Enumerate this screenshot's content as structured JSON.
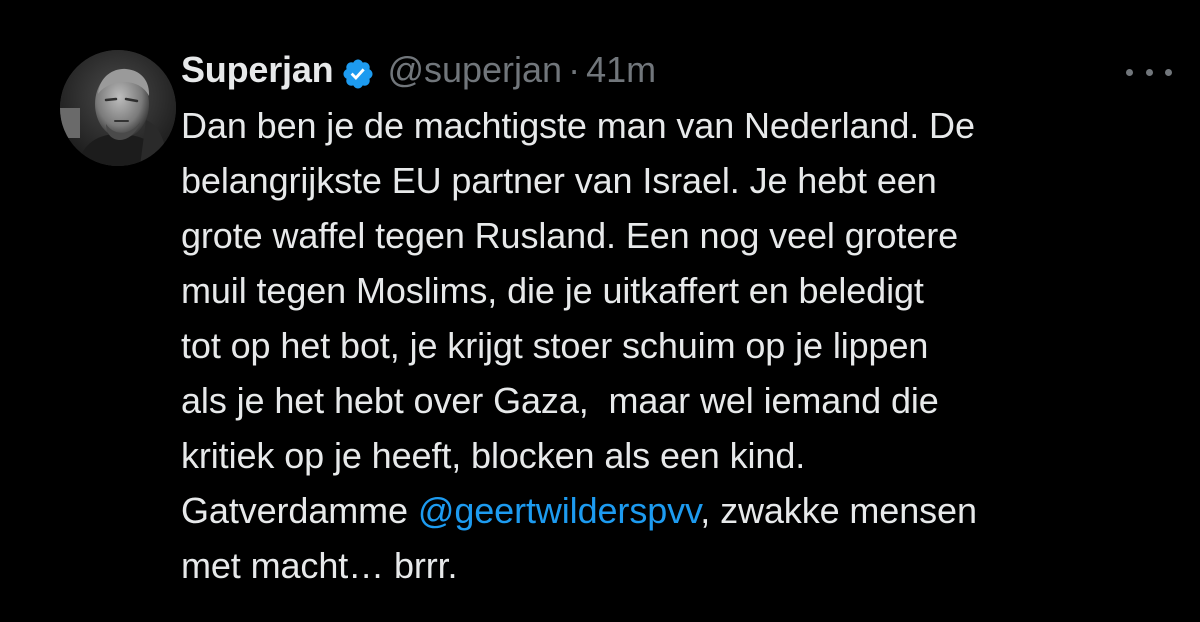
{
  "tweet": {
    "author": {
      "display_name": "Superjan",
      "handle": "@superjan",
      "verified": true,
      "verified_icon": "verified-badge-icon",
      "badge_color": "#1d9bf0"
    },
    "separator": "·",
    "time": "41m",
    "more_icon": "more-options-icon",
    "lines": [
      "Dan ben je de machtigste man van Nederland. De",
      "belangrijkste EU partner van Israel. Je hebt een",
      "grote waffel tegen Rusland. Een nog veel grotere",
      "muil tegen Moslims, die je uitkaffert en beledigt",
      "tot op het bot, je krijgt stoer schuim op je lippen",
      "als je het hebt over Gaza,  maar wel iemand die",
      "kritiek op je heeft, blocken als een kind."
    ],
    "line8_before": "Gatverdamme ",
    "mention": "@geertwilderspvv",
    "line8_after": ", zwakke mensen",
    "line9": "met macht… brrr.",
    "colors": {
      "background": "#000000",
      "text": "#e7e9ea",
      "muted": "#71767b",
      "link": "#1d9bf0"
    }
  }
}
